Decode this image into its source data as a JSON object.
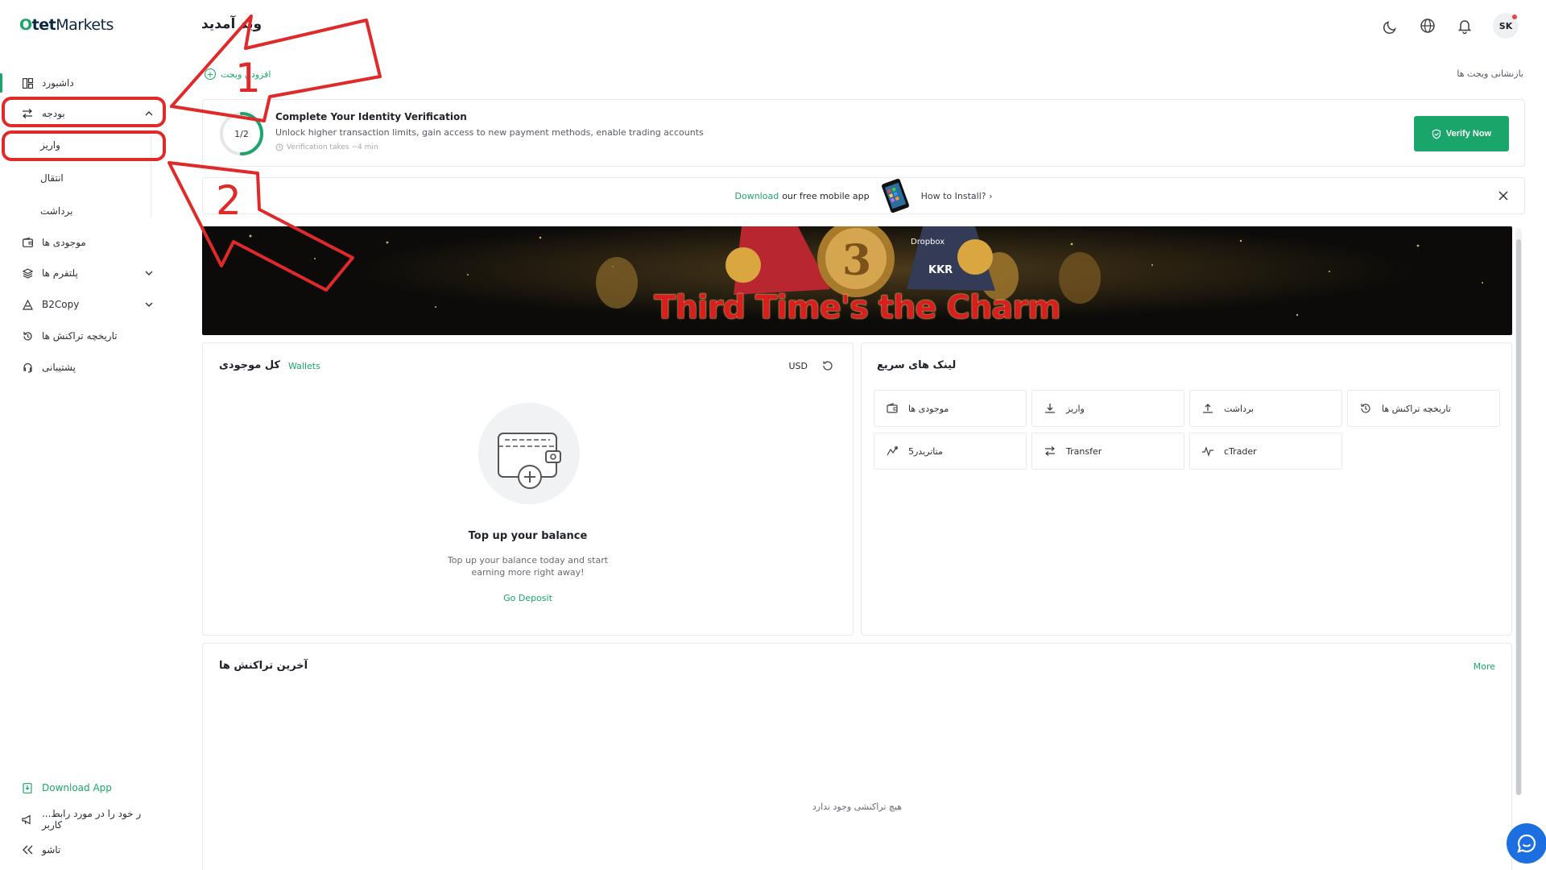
{
  "brand": {
    "logo_prefix": "O",
    "logo_bold": "tet",
    "logo_rest": "Markets",
    "accent": "#1aa66a",
    "annotation_color": "#e02a2a"
  },
  "sidebar": {
    "items": [
      {
        "label": "داشبورد",
        "icon": "dashboard-icon"
      },
      {
        "label": "بودجه",
        "icon": "transfer-arrows-icon"
      },
      {
        "label": "موجودی ها",
        "icon": "wallet-icon"
      },
      {
        "label": "پلتفرم ها",
        "icon": "layers-icon"
      },
      {
        "label": "B2Copy",
        "icon": "copy-trade-icon"
      },
      {
        "label": "تاریخچه تراکنش ها",
        "icon": "history-icon"
      },
      {
        "label": "پشتیبانی",
        "icon": "headset-icon"
      }
    ],
    "sub_items": [
      "واریز",
      "انتقال",
      "برداشت"
    ],
    "bottom": [
      {
        "label": "Download App",
        "icon": "download-app-icon"
      },
      {
        "label": "...ر خود را در مورد رابط کاربر",
        "icon": "megaphone-icon"
      },
      {
        "label": "تاشو",
        "icon": "collapse-icon"
      }
    ]
  },
  "header": {
    "welcome": "وید آمدید",
    "avatar": "SK"
  },
  "widgets": {
    "add": "افزودن ویجت",
    "reset": "بازنشانی ویجت ها"
  },
  "verification": {
    "progress_text": "1/2",
    "progress": 0.5,
    "title": "Complete Your Identity Verification",
    "desc": "Unlock higher transaction limits, gain access to new payment methods, enable trading accounts",
    "meta": "Verification takes ~4 min",
    "button": "Verify Now"
  },
  "appbar": {
    "download": "Download",
    "free": "our free mobile app",
    "how": "How to Install? ›"
  },
  "banner": {
    "title": "Third Time's the Charm"
  },
  "balance": {
    "title": "کل موجودی",
    "wallets": "Wallets",
    "currency": "USD",
    "empty_title": "Top up your balance",
    "empty_line1": "Top up your balance today and start",
    "empty_line2": "earning more right away!",
    "cta": "Go Deposit"
  },
  "quick_links": {
    "title": "لینک های سریع",
    "items": [
      {
        "label": "موجودی ها",
        "icon": "wallet-icon"
      },
      {
        "label": "واریز",
        "icon": "download-icon"
      },
      {
        "label": "برداشت",
        "icon": "upload-icon"
      },
      {
        "label": "تاریخچه تراکنش ها",
        "icon": "history-icon"
      },
      {
        "label": "متاتریدر5",
        "icon": "metatrader-icon"
      },
      {
        "label": "Transfer",
        "icon": "transfer-arrows-icon"
      },
      {
        "label": "cTrader",
        "icon": "ctrader-icon"
      }
    ]
  },
  "transactions": {
    "title": "آخرین تراکنش ها",
    "more": "More",
    "empty": "هیچ تراکنشی وجود ندارد"
  },
  "annotations": {
    "label_1": "1",
    "label_2": "2"
  }
}
